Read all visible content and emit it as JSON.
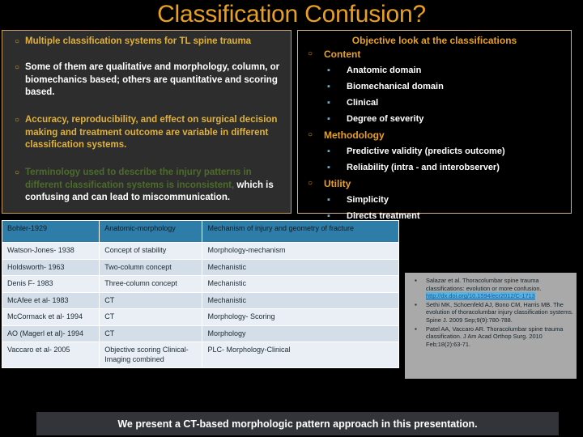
{
  "slide": {
    "title": "Classification Confusion?"
  },
  "left_panel": {
    "bullets": [
      {
        "marker": "○",
        "segments": [
          {
            "text": "Multiple classification systems for TL spine trauma",
            "color": "gold"
          }
        ]
      },
      {
        "marker": "○",
        "segments": [
          {
            "text": "Some of them are qualitative  and morphology, column, or biomechanics based; others are quantitative and scoring based.",
            "color": "white"
          }
        ]
      },
      {
        "marker": "○",
        "segments": [
          {
            "text": "Accuracy, reproducibility, and effect on surgical decision making and treatment outcome are variable in different classification systems.",
            "color": "gold"
          }
        ]
      },
      {
        "marker": "○",
        "segments": [
          {
            "text": "Terminology used to describe the injury patterns in different classification systems is inconsistent, ",
            "color": "green"
          },
          {
            "text": "which is confusing and can lead to miscommunication.",
            "color": "white"
          }
        ]
      }
    ]
  },
  "right_panel": {
    "heading": "Objective look at the classifications",
    "groups": [
      {
        "marker": "○",
        "label": "Content",
        "items": [
          {
            "marker": "▪",
            "label": "Anatomic domain"
          },
          {
            "marker": "▪",
            "label": "Biomechanical domain"
          },
          {
            "marker": "▪",
            "label": "Clinical"
          },
          {
            "marker": "▪",
            "label": "Degree of severity"
          }
        ]
      },
      {
        "marker": "○",
        "label": "Methodology",
        "items": [
          {
            "marker": "▪",
            "label": "Predictive validity (predicts outcome)"
          },
          {
            "marker": "▪",
            "label": "Reliability (intra - and interobserver)"
          }
        ]
      },
      {
        "marker": "○",
        "label": "Utility",
        "items": [
          {
            "marker": "▪",
            "label": "Simplicity"
          },
          {
            "marker": "▪",
            "label": "Directs treatment"
          }
        ]
      }
    ]
  },
  "table": {
    "header": [
      "Bohler-1929",
      "Anatomic-morphology",
      "Mechanism of injury and geometry of fracture"
    ],
    "rows": [
      [
        "Watson-Jones- 1938",
        "Concept of stability",
        "Morphology-mechanism"
      ],
      [
        "Holdsworth- 1963",
        "Two-column concept",
        "Mechanistic"
      ],
      [
        "Denis F- 1983",
        "Three-column concept",
        "Mechanistic"
      ],
      [
        "McAfee et al- 1983",
        "CT",
        "Mechanistic"
      ],
      [
        "McCormack et al- 1994",
        "CT",
        "Morphology- Scoring"
      ],
      [
        "AO (Magerl et al)- 1994",
        "CT",
        "Morphology"
      ],
      [
        "Vaccaro et al- 2005",
        "Objective scoring Clinical-Imaging combined",
        "PLC- Morphology-Clinical"
      ]
    ]
  },
  "references": {
    "marker": "▪",
    "items": [
      {
        "text": "Salazar et al. Thoracolumbar spine trauma classifications: evolution or more confusion.",
        "link": "http://dx.doi.org/10.1594/ecr2012/C-1713"
      },
      {
        "text": "Sethi MK, Schoenfeld AJ, Bono CM, Harris MB. The evolution of thoracolumbar injury classification systems. Spine J. 2009 Sep;9(9):780-788.",
        "link": ""
      },
      {
        "text": "Patel AA, Vaccaro AR. Thoracolumbar spine trauma classification. J Am Acad Orthop Surg. 2010 Feb;18(2):63-71.",
        "link": ""
      }
    ]
  },
  "bottom_banner": {
    "text": "We present a CT-based morphologic pattern approach in this presentation."
  },
  "colors": {
    "title_gold": "#E8A020",
    "body_gold": "#E0B13C",
    "green": "#4D6B2A",
    "table_header_blue": "#2E7CA8",
    "row_light": "#E9EFF4",
    "row_dark": "#D3DEE8",
    "banner_bg": "#33343A",
    "ref_bg": "#A9A9A9"
  }
}
